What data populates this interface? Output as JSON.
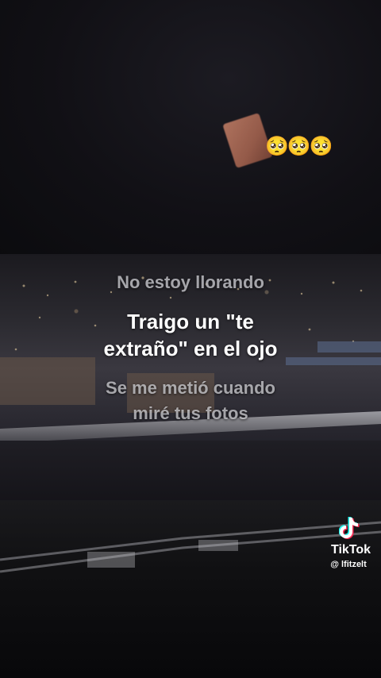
{
  "emoji_row": "🥺🥺🥺",
  "captions": {
    "line1": "No estoy llorando",
    "line2a": "Traigo un \"te",
    "line2b": "extraño\" en el ojo",
    "line3a": "Se me metió cuando",
    "line3b": "miré tus fotos"
  },
  "watermark": {
    "brand": "TikTok",
    "username": "@ lfitzelt",
    "icon": "tiktok-logo-icon"
  }
}
